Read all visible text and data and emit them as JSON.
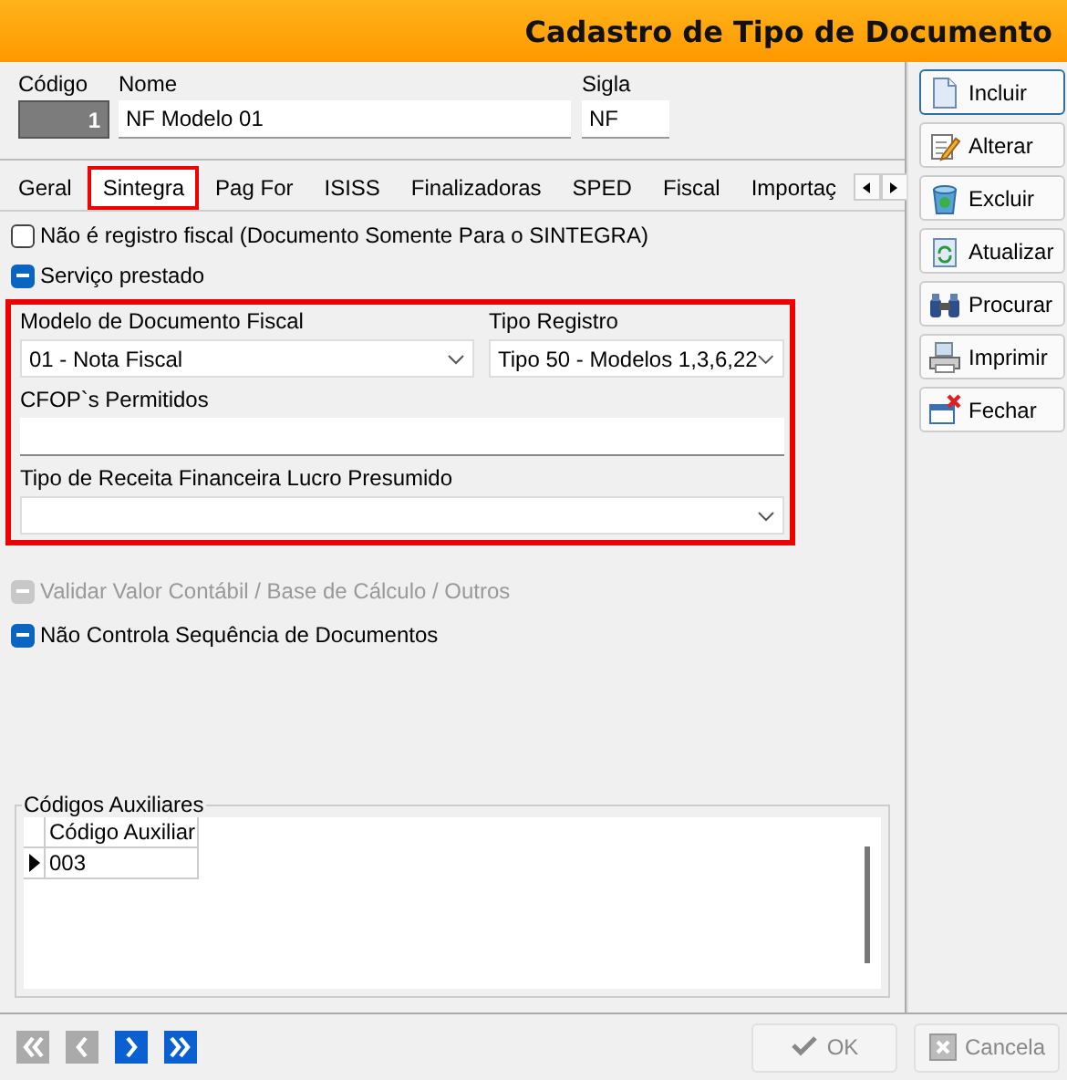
{
  "window": {
    "title": "Cadastro de Tipo de Documento"
  },
  "header_fields": [
    {
      "label": "Código",
      "value": "1",
      "kind": "readonly"
    },
    {
      "label": "Nome",
      "value": "NF Modelo 01",
      "kind": "text"
    },
    {
      "label": "Sigla",
      "value": "NF",
      "kind": "text"
    }
  ],
  "tabs": [
    {
      "label": "Geral",
      "selected": false,
      "highlighted": false
    },
    {
      "label": "Sintegra",
      "selected": true,
      "highlighted": true
    },
    {
      "label": "Pag For",
      "selected": false,
      "highlighted": false
    },
    {
      "label": "ISISS",
      "selected": false,
      "highlighted": false
    },
    {
      "label": "Finalizadoras",
      "selected": false,
      "highlighted": false
    },
    {
      "label": "SPED",
      "selected": false,
      "highlighted": false
    },
    {
      "label": "Fiscal",
      "selected": false,
      "highlighted": false
    },
    {
      "label": "Importaç",
      "selected": false,
      "highlighted": false
    }
  ],
  "top_options": [
    {
      "label": "Não é registro fiscal (Documento Somente Para o SINTEGRA)",
      "checked": false,
      "disabled": false
    },
    {
      "label": "Serviço prestado",
      "checked": true,
      "disabled": false
    }
  ],
  "fiscal_group": {
    "highlighted": true,
    "modelo": {
      "label": "Modelo de Documento Fiscal",
      "value": "01 - Nota Fiscal"
    },
    "tipo_registro": {
      "label": "Tipo Registro",
      "value": "Tipo 50 - Modelos 1,3,6,22"
    },
    "cfops": {
      "label": "CFOP`s Permitidos"
    },
    "tipo_receita": {
      "label": "Tipo de Receita Financeira Lucro Presumido"
    }
  },
  "bottom_options": [
    {
      "label": "Validar Valor Contábil / Base de Cálculo / Outros",
      "checked": true,
      "disabled": true
    },
    {
      "label": "Não Controla Sequência de Documentos",
      "checked": true,
      "disabled": false
    }
  ],
  "auxiliary_codes": {
    "title": "Códigos Auxiliares",
    "column": "Código Auxiliar",
    "rows": [
      {
        "value": "003",
        "selected": true
      }
    ]
  },
  "side_buttons": [
    {
      "label": "Incluir",
      "kind": "new",
      "focused": true
    },
    {
      "label": "Alterar",
      "kind": "edit",
      "focused": false
    },
    {
      "label": "Excluir",
      "kind": "delete",
      "focused": false
    },
    {
      "label": "Atualizar",
      "kind": "refresh",
      "focused": false
    },
    {
      "label": "Procurar",
      "kind": "search",
      "focused": false
    },
    {
      "label": "Imprimir",
      "kind": "print",
      "focused": false
    },
    {
      "label": "Fechar",
      "kind": "close",
      "focused": false
    }
  ],
  "navigation": [
    {
      "kind": "first",
      "disabled": true
    },
    {
      "kind": "prev",
      "disabled": true
    },
    {
      "kind": "next",
      "disabled": false
    },
    {
      "kind": "last",
      "disabled": false
    }
  ],
  "footer_buttons": [
    {
      "label": "OK",
      "kind": "ok",
      "disabled": true
    },
    {
      "label": "Cancela",
      "kind": "cancel",
      "disabled": true
    }
  ]
}
